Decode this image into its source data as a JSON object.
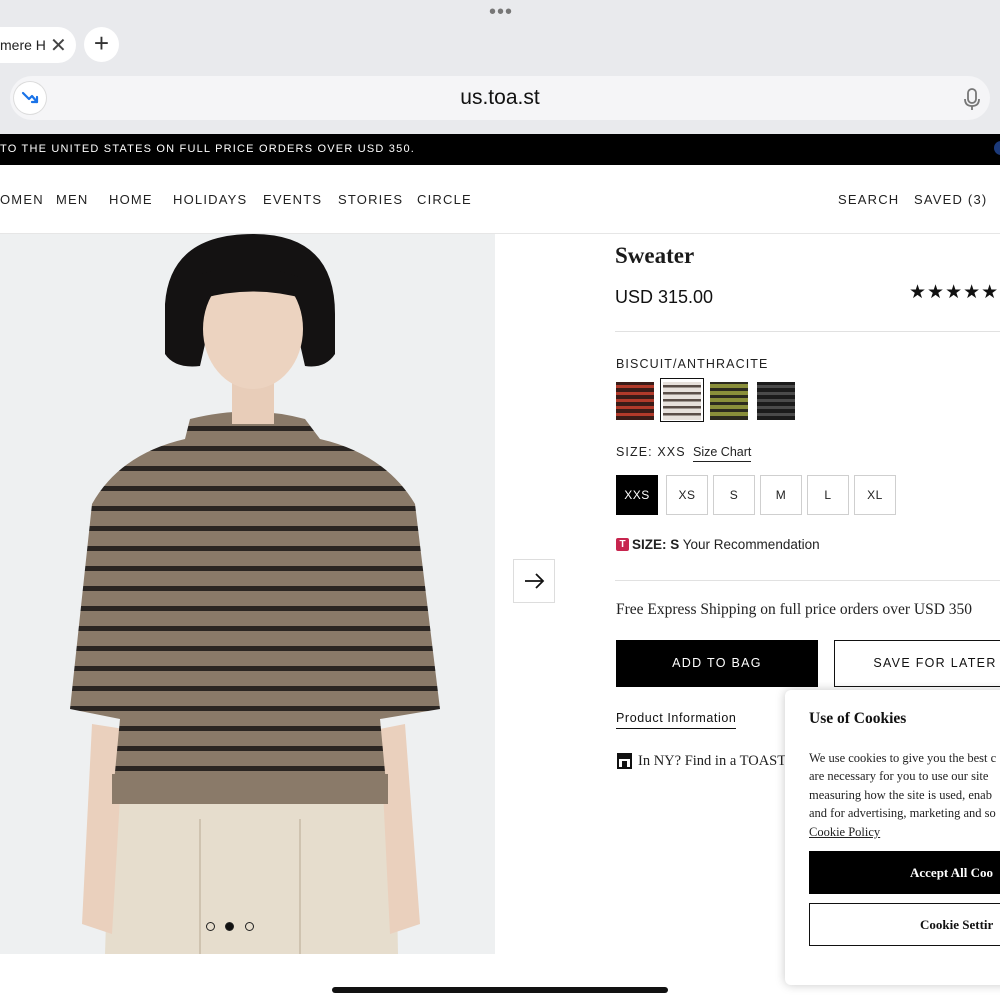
{
  "browser": {
    "tab_title": "mere H",
    "url": "us.toa.st",
    "icons": [
      "more-dots-icon",
      "close-icon",
      "plus-icon",
      "trending-icon",
      "microphone-icon"
    ]
  },
  "promo": {
    "text": "TO THE UNITED STATES ON FULL PRICE ORDERS OVER USD 350."
  },
  "nav": {
    "items": [
      "OMEN",
      "MEN",
      "HOME",
      "HOLIDAYS",
      "EVENTS",
      "STORIES",
      "CIRCLE"
    ],
    "search": "SEARCH",
    "saved": "SAVED (3)"
  },
  "product": {
    "title": "Sweater",
    "price": "USD 315.00",
    "rating_stars": "★★★★★",
    "color_name": "BISCUIT/ANTHRACITE",
    "swatches": [
      {
        "stripe": "#b23a2a",
        "base": "#3a1c18",
        "selected": false
      },
      {
        "stripe": "#8a7b70",
        "base": "#e7e1dc",
        "selected": true
      },
      {
        "stripe": "#8a8f3a",
        "base": "#2c2a1f",
        "selected": false
      },
      {
        "stripe": "#4a4a4a",
        "base": "#1b1b1b",
        "selected": false
      }
    ],
    "size_label": "SIZE: XXS",
    "size_chart": "Size Chart",
    "sizes": [
      "XXS",
      "XS",
      "S",
      "M",
      "L",
      "XL"
    ],
    "selected_size": "XXS",
    "recommendation_badge": "T",
    "recommendation_size": "SIZE: S",
    "recommendation_text": " Your Recommendation",
    "shipping": "Free Express Shipping on full price orders over USD 350",
    "add_to_bag": "ADD TO BAG",
    "save_for_later": "SAVE FOR LATER",
    "product_information": "Product Information",
    "store_text": "In NY? Find in a TOAST",
    "carousel_dots": 3,
    "carousel_active": 1
  },
  "cookies": {
    "title": "Use of Cookies",
    "lines": [
      "We use cookies to give you the best c",
      "are necessary for you to use our site",
      "measuring how the site is used, enab",
      "and for advertising, marketing and so"
    ],
    "policy_link": "Cookie Policy",
    "accept_label": "Accept All Coo",
    "settings_label": "Cookie Settir"
  },
  "colors": {
    "accent": "#000000",
    "recommendation_badge": "#c7254e"
  }
}
